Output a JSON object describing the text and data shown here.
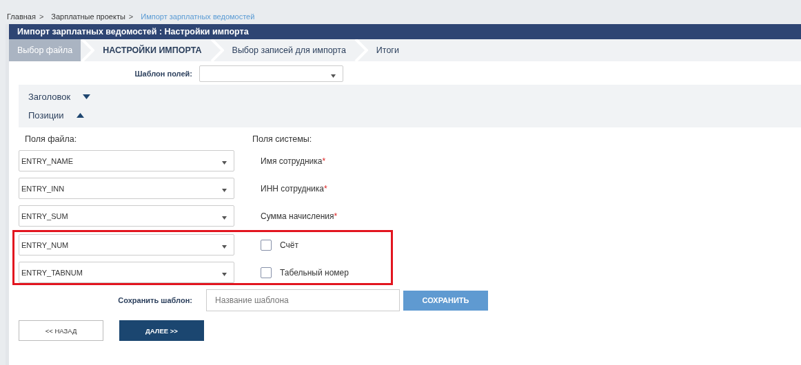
{
  "breadcrumbs": [
    {
      "label": "Главная",
      "current": false
    },
    {
      "label": "Зарплатные проекты",
      "current": false
    },
    {
      "label": "Импорт зарплатных ведомостей",
      "current": true
    }
  ],
  "breadcrumb_separator": ">",
  "required_mark": "*",
  "title": "Импорт зарплатных ведомостей : Настройки импорта",
  "steps": [
    {
      "label": "Выбор файла",
      "selected": false,
      "completed": true
    },
    {
      "label": "НАСТРОЙКИ ИМПОРТА",
      "selected": true,
      "completed": false
    },
    {
      "label": "Выбор записей для импорта",
      "selected": false,
      "completed": false
    },
    {
      "label": "Итоги",
      "selected": false,
      "completed": false
    }
  ],
  "template_select": {
    "label": "Шаблон полей:"
  },
  "sections": [
    {
      "label": "Заголовок",
      "expanded": false
    },
    {
      "label": "Позиции",
      "expanded": true
    }
  ],
  "file_fields_heading": "Поля файла:",
  "system_fields_heading": "Поля системы:",
  "mappings": [
    {
      "file_field": "ENTRY_NAME",
      "system_field": "Имя сотрудника",
      "kind": "label",
      "required": true,
      "highlighted": false
    },
    {
      "file_field": "ENTRY_INN",
      "system_field": "ИНН сотрудника",
      "kind": "label",
      "required": true,
      "highlighted": false
    },
    {
      "file_field": "ENTRY_SUM",
      "system_field": "Сумма начисления",
      "kind": "label",
      "required": true,
      "highlighted": false
    },
    {
      "file_field": "ENTRY_NUM",
      "system_field": "Счёт",
      "kind": "checkbox",
      "checked": false,
      "highlighted": true
    },
    {
      "file_field": "ENTRY_TABNUM",
      "system_field": "Табельный номер",
      "kind": "checkbox",
      "checked": false,
      "highlighted": true
    }
  ],
  "save_template": {
    "label": "Сохранить шаблон:",
    "placeholder": "Название шаблона",
    "button": "СОХРАНИТЬ"
  },
  "buttons": [
    {
      "label": "<< НАЗАД",
      "kind": "secondary"
    },
    {
      "label": "ДАЛЕЕ >>",
      "kind": "primary"
    }
  ]
}
